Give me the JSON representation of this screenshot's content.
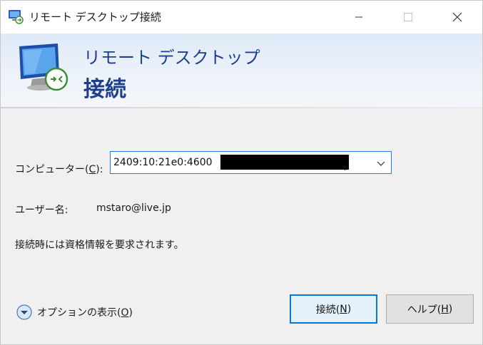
{
  "window": {
    "title": "リモート デスクトップ接続",
    "icons": {
      "app": "remote-desktop-icon",
      "minimize": "minimize-icon",
      "maximize": "maximize-icon",
      "close": "close-icon"
    }
  },
  "header": {
    "line1": "リモート デスクトップ",
    "line2": "接続",
    "icon": "monitor-connection-icon"
  },
  "form": {
    "computer_label_before": "コンピューター(",
    "computer_label_key": "C",
    "computer_label_after": "):",
    "computer_value": "2409:10:21e0:4600",
    "username_label": "ユーザー名:",
    "username_value": "mstaro@live.jp",
    "notice": "接続時には資格情報を要求されます。"
  },
  "footer": {
    "options_before": "オプションの表示(",
    "options_key": "O",
    "options_after": ")",
    "connect_before": "接続(",
    "connect_key": "N",
    "connect_after": ")",
    "help_before": "ヘルプ(",
    "help_key": "H",
    "help_after": ")"
  },
  "colors": {
    "accent": "#0078d7",
    "header_text": "#1d3f8c",
    "background": "#f0f0f0"
  }
}
